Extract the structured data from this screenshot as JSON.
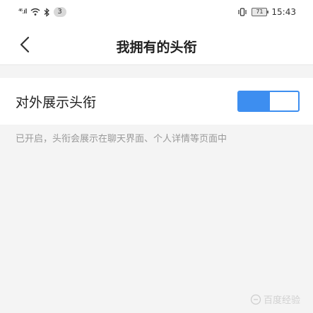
{
  "status_bar": {
    "signal_text": "⁴⁶.ıll",
    "notification_count": "3",
    "battery": "71",
    "time": "15:43"
  },
  "header": {
    "title": "我拥有的头衔"
  },
  "settings": {
    "row_label": "对外展示头衔",
    "toggle_on": true,
    "hint": "已开启，头衔会展示在聊天界面、个人详情等页面中"
  },
  "watermark": "百度经验",
  "colors": {
    "accent": "#3d8ef0",
    "background": "#f4f4f4"
  }
}
